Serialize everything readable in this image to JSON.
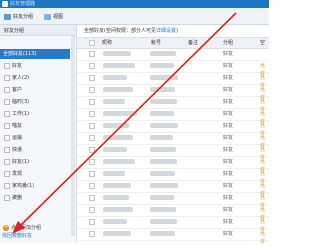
{
  "window": {
    "title": "好友管理器"
  },
  "toolbar": {
    "buttons": [
      {
        "label": "好友分组",
        "icon": "group-icon"
      },
      {
        "label": "视图",
        "icon": "view-icon"
      }
    ]
  },
  "sidebar": {
    "header": "好友分组",
    "groups": [
      {
        "label": "全部好友(113)",
        "selected": true
      },
      {
        "label": "好友"
      },
      {
        "label": "家人(2)"
      },
      {
        "label": "客户"
      },
      {
        "label": "临时(3)"
      },
      {
        "label": "工作(1)"
      },
      {
        "label": "喵友"
      },
      {
        "label": "运输"
      },
      {
        "label": "快递"
      },
      {
        "label": "好友(1)"
      },
      {
        "label": "发现"
      },
      {
        "label": "家鸡番(1)"
      },
      {
        "label": "被删"
      }
    ],
    "add_group": "点击添加分组",
    "find_link": "找回被删好友"
  },
  "main": {
    "info_prefix": "全部好友(空间权限：部分人可见",
    "info_link": "详细设置",
    "info_suffix": ")",
    "columns": [
      "昵称",
      "帐号",
      "备注",
      "分组"
    ],
    "cut_column": "空",
    "rows": [
      {
        "group": "好友"
      },
      {
        "group": "好友",
        "note": "允许"
      },
      {
        "group": "好友",
        "note": "允许"
      },
      {
        "group": "好友",
        "note": "允许"
      },
      {
        "group": "好友",
        "note": "允许"
      },
      {
        "group": "好友",
        "note": "允许"
      },
      {
        "group": "好友",
        "note": "允许"
      },
      {
        "group": "好友",
        "note": "允许"
      },
      {
        "group": "好友",
        "note": "允许"
      },
      {
        "group": "好友",
        "note": "允许"
      },
      {
        "group": "好友",
        "note": "允许"
      },
      {
        "group": "好友",
        "note": "允许"
      },
      {
        "group": "好友",
        "note": "允许"
      },
      {
        "group": "好友",
        "note": "允许"
      },
      {
        "group": "好友",
        "note": "允许"
      },
      {
        "group": "好友",
        "note": "允许"
      }
    ]
  },
  "annotation": {
    "color": "#e02020"
  }
}
